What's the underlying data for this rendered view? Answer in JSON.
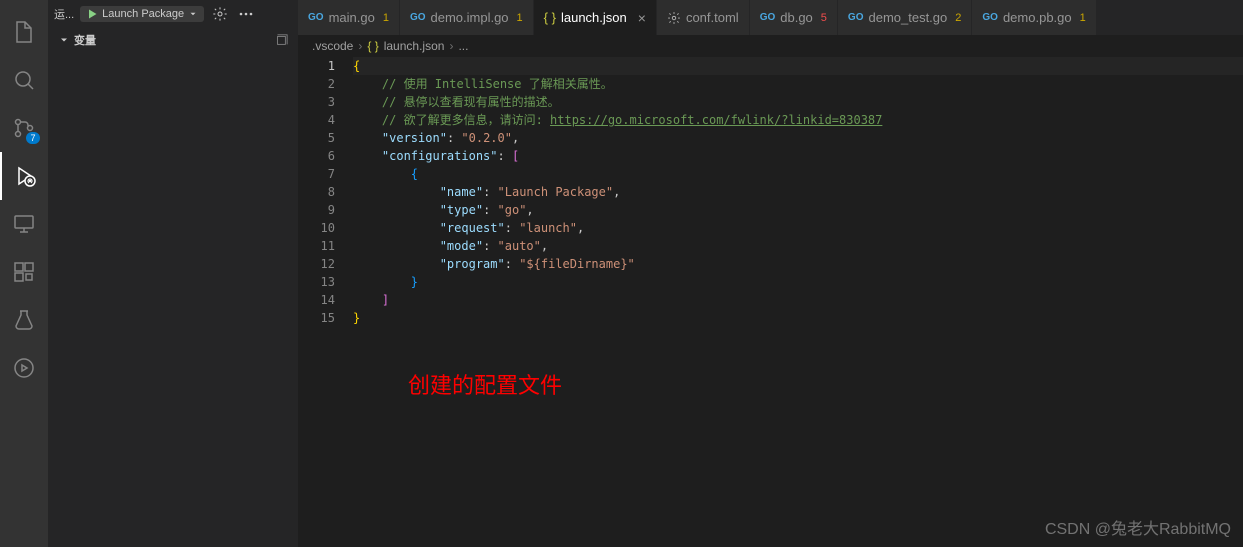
{
  "activity_bar": {
    "scm_badge": "7"
  },
  "debug_toolbar": {
    "run_label": "运...",
    "config_name": "Launch Package"
  },
  "sidebar": {
    "section_label": "变量"
  },
  "tabs": [
    {
      "icon": "go",
      "label": "main.go",
      "badge": "1",
      "badge_color": "yellow",
      "active": false
    },
    {
      "icon": "go",
      "label": "demo.impl.go",
      "badge": "1",
      "badge_color": "yellow",
      "active": false
    },
    {
      "icon": "json",
      "label": "launch.json",
      "badge": "",
      "badge_color": "",
      "active": true
    },
    {
      "icon": "toml",
      "label": "conf.toml",
      "badge": "",
      "badge_color": "",
      "active": false
    },
    {
      "icon": "go",
      "label": "db.go",
      "badge": "5",
      "badge_color": "red",
      "active": false
    },
    {
      "icon": "go",
      "label": "demo_test.go",
      "badge": "2",
      "badge_color": "yellow",
      "active": false
    },
    {
      "icon": "go",
      "label": "demo.pb.go",
      "badge": "1",
      "badge_color": "yellow",
      "active": false
    }
  ],
  "breadcrumb": {
    "folder": ".vscode",
    "file": "launch.json",
    "trail": "..."
  },
  "code": {
    "comment1": "// 使用 IntelliSense 了解相关属性。",
    "comment2": "// 悬停以查看现有属性的描述。",
    "comment3_prefix": "// 欲了解更多信息，请访问: ",
    "comment3_link": "https://go.microsoft.com/fwlink/?linkid=830387",
    "k_version": "\"version\"",
    "v_version": "\"0.2.0\"",
    "k_configurations": "\"configurations\"",
    "k_name": "\"name\"",
    "v_name": "\"Launch Package\"",
    "k_type": "\"type\"",
    "v_type": "\"go\"",
    "k_request": "\"request\"",
    "v_request": "\"launch\"",
    "k_mode": "\"mode\"",
    "v_mode": "\"auto\"",
    "k_program": "\"program\"",
    "v_program": "\"${fileDirname}\""
  },
  "line_numbers": [
    "1",
    "2",
    "3",
    "4",
    "5",
    "6",
    "7",
    "8",
    "9",
    "10",
    "11",
    "12",
    "13",
    "14",
    "15"
  ],
  "annotation": "创建的配置文件",
  "watermark": "CSDN @兔老大RabbitMQ"
}
